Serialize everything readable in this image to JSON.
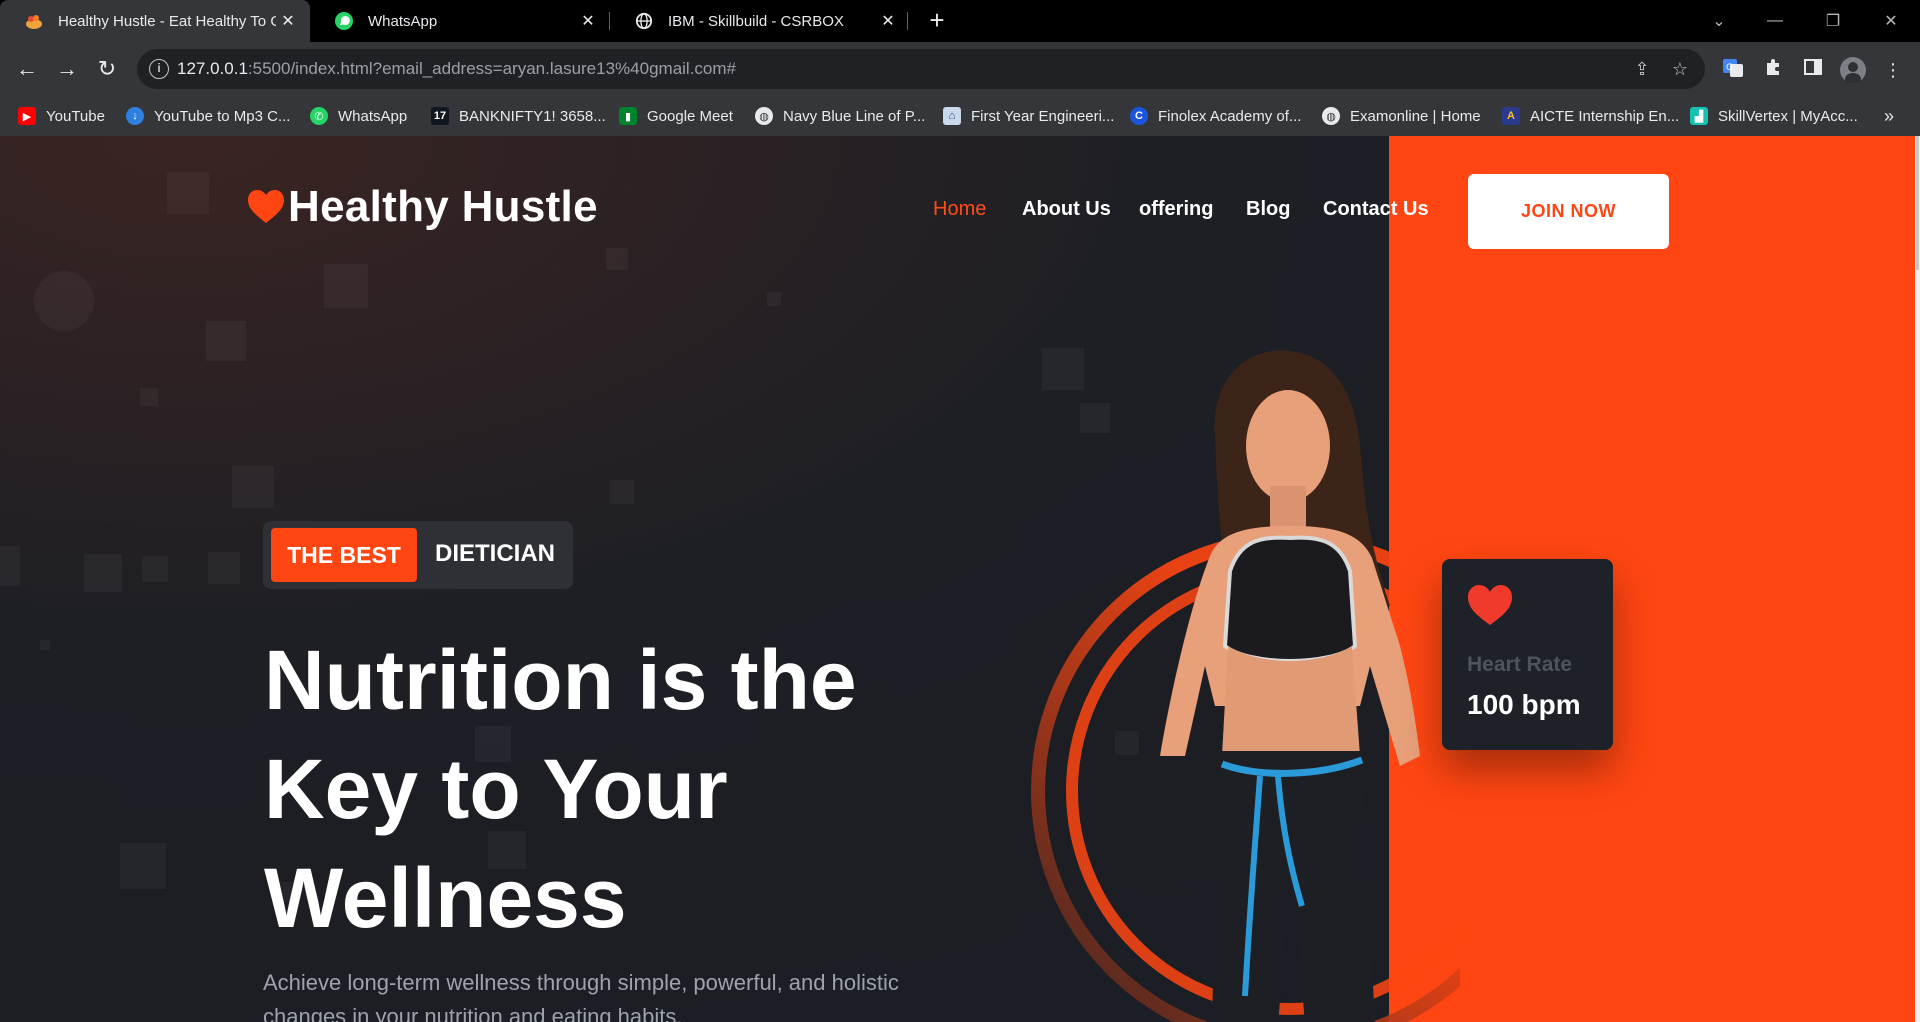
{
  "browser": {
    "tabs": [
      {
        "title": "Healthy Hustle - Eat Healthy To G",
        "icon": "salad-icon",
        "active": true
      },
      {
        "title": "WhatsApp",
        "icon": "whatsapp-icon",
        "active": false
      },
      {
        "title": "IBM - Skillbuild - CSRBOX",
        "icon": "globe-icon",
        "active": false
      }
    ],
    "url_host": "127.0.0.1",
    "url_rest": ":5500/index.html?email_address=aryan.lasure13%40gmail.com#",
    "bookmarks": [
      {
        "label": "YouTube",
        "icon": "youtube-icon",
        "color": "#ff0000"
      },
      {
        "label": "YouTube to Mp3 C...",
        "icon": "download-icon",
        "color": "#2f7fe0"
      },
      {
        "label": "WhatsApp",
        "icon": "whatsapp-icon",
        "color": "#25d366"
      },
      {
        "label": "BANKNIFTY1! 3658...",
        "icon": "tradingview-icon",
        "color": "#131722"
      },
      {
        "label": "Google Meet",
        "icon": "meet-icon",
        "color": "#00832d"
      },
      {
        "label": "Navy Blue Line of P...",
        "icon": "globe-icon",
        "color": "#5f6368"
      },
      {
        "label": "First Year Engineeri...",
        "icon": "college-icon",
        "color": "#c9d8ea"
      },
      {
        "label": "Finolex Academy of...",
        "icon": "finolex-icon",
        "color": "#1a56db"
      },
      {
        "label": "Examonline | Home",
        "icon": "globe-icon",
        "color": "#5f6368"
      },
      {
        "label": "AICTE Internship En...",
        "icon": "aicte-icon",
        "color": "#2b3a8c"
      },
      {
        "label": "SkillVertex | MyAcc...",
        "icon": "skillvertex-icon",
        "color": "#13c2b1"
      }
    ]
  },
  "site": {
    "logo_text": "Healthy Hustle",
    "nav": [
      {
        "label": "Home",
        "active": true
      },
      {
        "label": "About Us",
        "active": false
      },
      {
        "label": "offering",
        "active": false
      },
      {
        "label": "Blog",
        "active": false
      },
      {
        "label": "Contact Us",
        "active": false
      }
    ],
    "cta_label": "JOIN NOW",
    "badge_highlight": "THE BEST",
    "badge_text": "DIETICIAN",
    "hero_title_line1": "Nutrition is the",
    "hero_title_line2": "Key to Your",
    "hero_title_line3": "Wellness",
    "hero_subtitle": "Achieve long-term wellness through simple, powerful, and holistic changes in your nutrition and eating habits.",
    "heart_card_label": "Heart Rate",
    "heart_card_value": "100 bpm",
    "colors": {
      "accent": "#ff4612",
      "dark_bg": "#1a1d23",
      "card_bg": "#1e2128"
    }
  }
}
